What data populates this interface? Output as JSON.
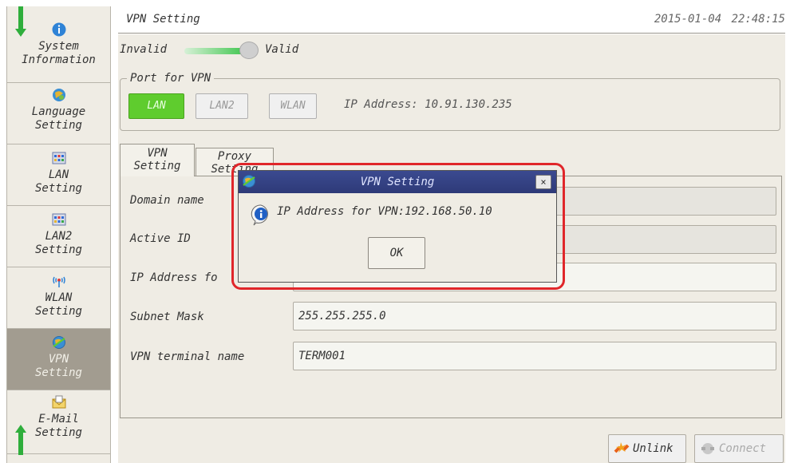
{
  "header": {
    "title": "VPN Setting",
    "datetime": "2015-01-04  22:48:15"
  },
  "sidebar": {
    "items": [
      {
        "label": "System\nInformation",
        "icon": "info-icon"
      },
      {
        "label": "Language\nSetting",
        "icon": "language-icon"
      },
      {
        "label": "LAN\nSetting",
        "icon": "lan-icon"
      },
      {
        "label": "LAN2\nSetting",
        "icon": "lan-icon"
      },
      {
        "label": "WLAN\nSetting",
        "icon": "wifi-icon"
      },
      {
        "label": "VPN\nSetting",
        "icon": "vpn-icon",
        "active": true
      },
      {
        "label": "E-Mail\nSetting",
        "icon": "mail-icon"
      }
    ]
  },
  "toggle": {
    "off_label": "Invalid",
    "on_label": "Valid",
    "state": "valid"
  },
  "port": {
    "legend": "Port for VPN",
    "buttons": [
      "LAN",
      "LAN2",
      "WLAN"
    ],
    "selected": "LAN",
    "ip_address": "IP Address: 10.91.130.235"
  },
  "tabs": [
    {
      "label": "VPN\nSetting",
      "active": true
    },
    {
      "label": "Proxy\nSetting",
      "active": false
    }
  ],
  "form": {
    "domain_name": {
      "label": "Domain name",
      "value": ""
    },
    "active_id": {
      "label": "Active ID",
      "value": ""
    },
    "ip_address": {
      "label": "IP Address fo",
      "value": ""
    },
    "subnet_mask": {
      "label": "Subnet Mask",
      "value": "255.255.255.0"
    },
    "terminal_name": {
      "label": "VPN terminal name",
      "value": "TERM001"
    }
  },
  "bottom_buttons": {
    "unlink": "Unlink",
    "connect": "Connect"
  },
  "dialog": {
    "title": "VPN Setting",
    "message": "IP Address for VPN:192.168.50.10",
    "ok_label": "OK",
    "close_label": "×"
  },
  "colors": {
    "accent_green": "#5fcc2e",
    "dialog_title": "#2e3a78",
    "highlight": "#e0262a",
    "active_sidebar": "#a29c90"
  }
}
